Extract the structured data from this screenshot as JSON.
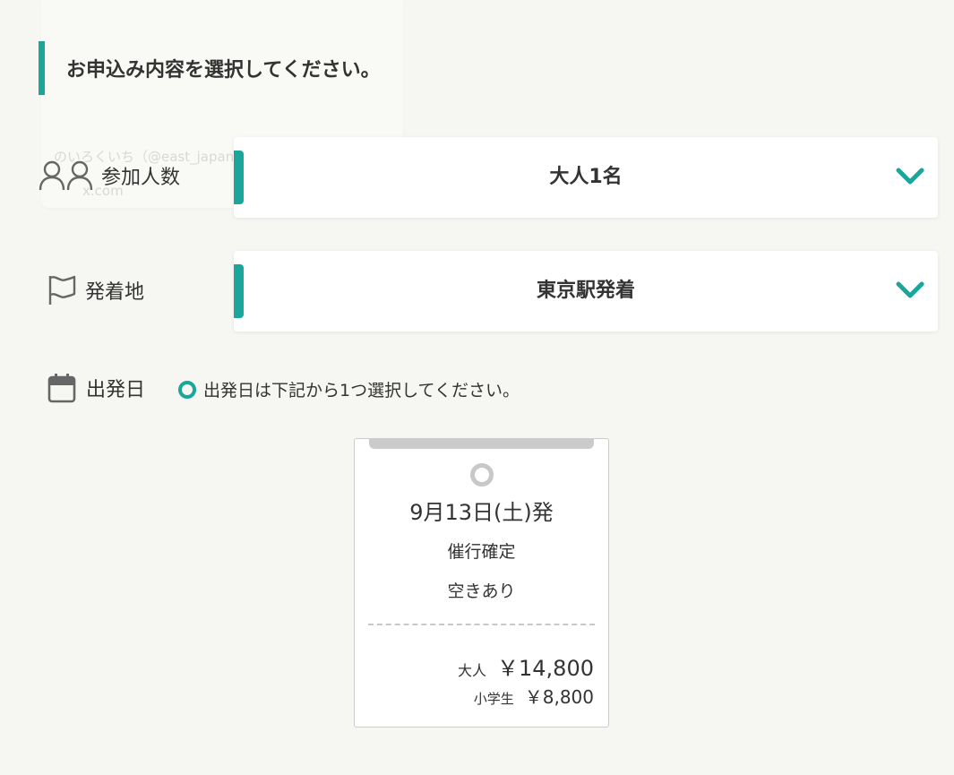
{
  "heading": "お申込み内容を選択してください。",
  "ghost_tooltip": {
    "line1": "のいろくいち（@east_japan_ さん / X",
    "line2": "x.com"
  },
  "participants": {
    "label": "参加人数",
    "value": "大人1名"
  },
  "departure_place": {
    "label": "発着地",
    "value": "東京駅発着"
  },
  "departure_date": {
    "label": "出発日",
    "note": "出発日は下記から1つ選択してください。"
  },
  "date_card": {
    "date": "9月13日(土)発",
    "status_confirmed": "催行確定",
    "availability": "空きあり",
    "adult_label": "大人",
    "adult_price": "￥14,800",
    "child_label": "小学生",
    "child_price": "￥8,800"
  },
  "colors": {
    "accent": "#1aa69b",
    "background": "#f6f6f2",
    "text": "#333333"
  },
  "icons": [
    "people-icon",
    "flag-icon",
    "calendar-icon",
    "chevron-down-icon"
  ]
}
